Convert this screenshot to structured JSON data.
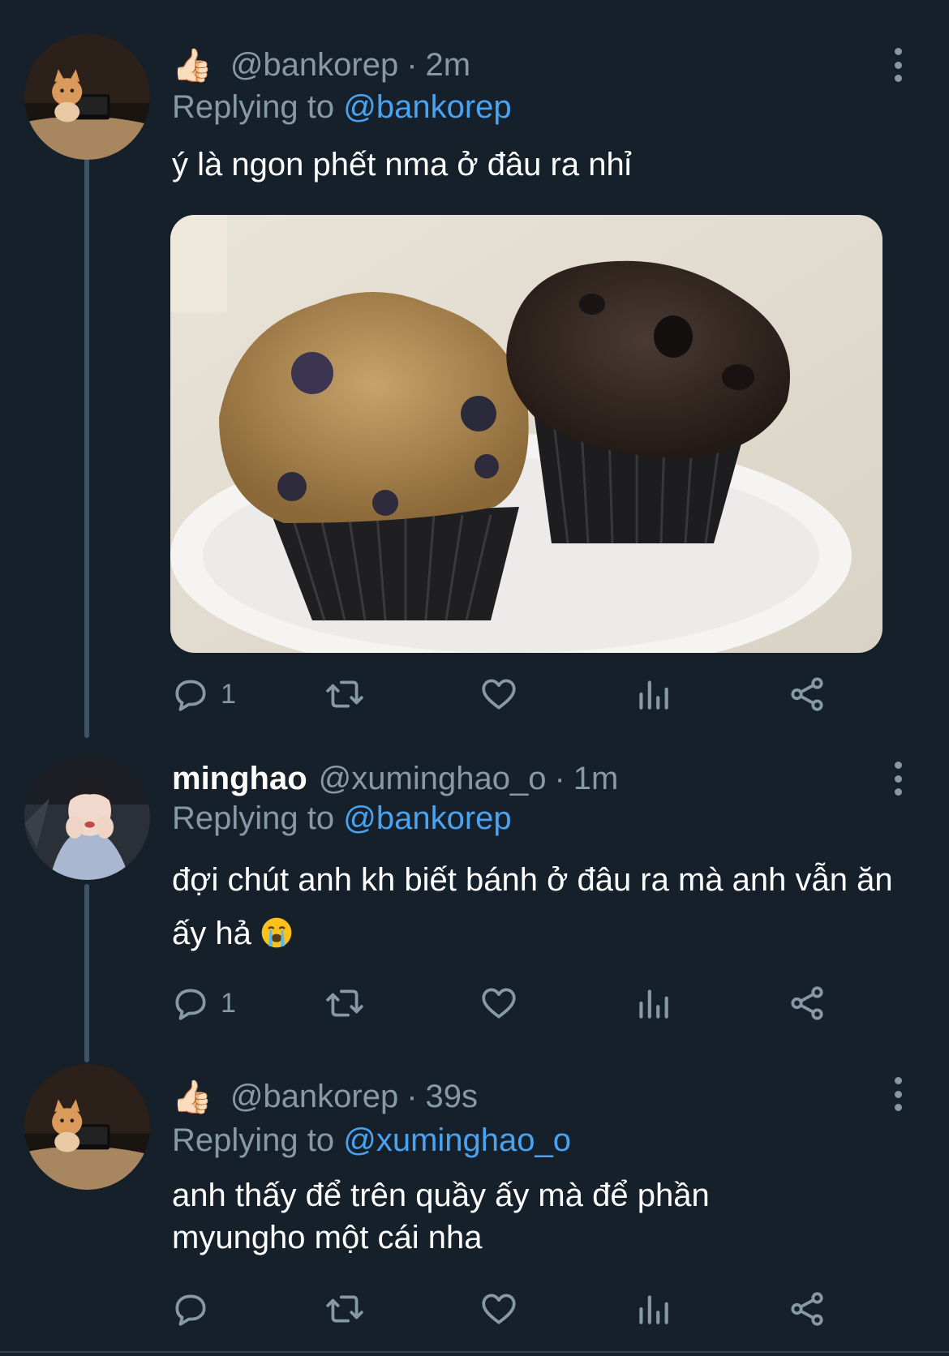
{
  "tweets": [
    {
      "display_name": "",
      "name_emoji": "👍🏻",
      "handle": "@bankorep",
      "separator": "·",
      "time": "2m",
      "replying_prefix": "Replying to",
      "replying_to": "@bankorep",
      "text": "ý là ngon phết nma ở đâu ra nhỉ",
      "media": {
        "description_icon": "muffins-photo"
      },
      "reply_count": "1",
      "avatar_icon": "cat-avatar-icon"
    },
    {
      "display_name": "minghao",
      "handle": "@xuminghao_o",
      "separator": "·",
      "time": "1m",
      "replying_prefix": "Replying to",
      "replying_to": "@bankorep",
      "text": "đợi chút anh kh biết bánh ở đâu ra mà anh vẫn ăn ấy hả",
      "text_emoji": "😭",
      "reply_count": "1",
      "avatar_icon": "person-avatar-icon"
    },
    {
      "display_name": "",
      "name_emoji": "👍🏻",
      "handle": "@bankorep",
      "separator": "·",
      "time": "39s",
      "replying_prefix": "Replying to",
      "replying_to": "@xuminghao_o",
      "text_line1": "anh thấy để trên quầy ấy mà để phần",
      "text_line2": "myungho một cái nha",
      "reply_count": "",
      "avatar_icon": "cat-avatar-icon"
    }
  ],
  "colors": {
    "background": "#15202b",
    "secondary_text": "#8899a6",
    "link": "#4aa3f0",
    "thread_line": "#3d5466"
  }
}
